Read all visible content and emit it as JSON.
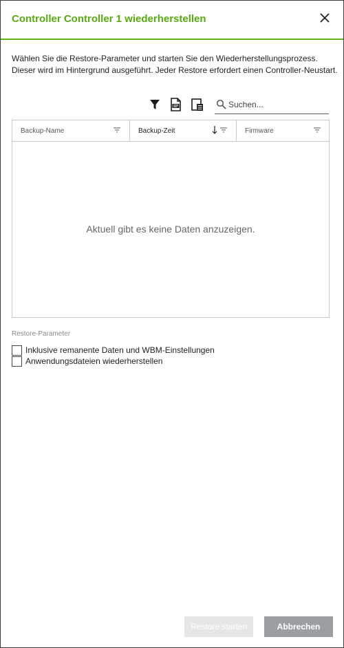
{
  "dialog": {
    "title": "Controller Controller 1 wiederherstellen",
    "description_line1": "Wählen Sie die Restore-Parameter und starten Sie den Wiederherstellungsprozess.",
    "description_line2": "Dieser wird im Hintergrund ausgeführt. Jeder Restore erfordert einen Controller-Neustart."
  },
  "toolbar": {
    "icons": [
      "filter-icon",
      "export-file-icon",
      "column-settings-icon"
    ],
    "search_placeholder": "Suchen..."
  },
  "table": {
    "columns": [
      {
        "label": "Backup-Name",
        "sorted": false
      },
      {
        "label": "Backup-Zeit",
        "sorted": true,
        "sort_direction": "descending"
      },
      {
        "label": "Firmware",
        "sorted": false
      }
    ],
    "empty_message": "Aktuell gibt es keine Daten anzuzeigen."
  },
  "restore_params": {
    "label": "Restore-Parameter",
    "options": [
      {
        "label": "Inklusive remanente Daten und WBM-Einstellungen",
        "checked": false
      },
      {
        "label": "Anwendungsdateien wiederherstellen",
        "checked": false
      }
    ]
  },
  "buttons": {
    "restore_label": "Restore starten",
    "cancel_label": "Abbrechen"
  },
  "colors": {
    "accent": "#57ab11",
    "header_rule": "#64b40f",
    "cancel_bg": "#9b9ea3",
    "restore_disabled_bg": "#e6e6e6"
  }
}
